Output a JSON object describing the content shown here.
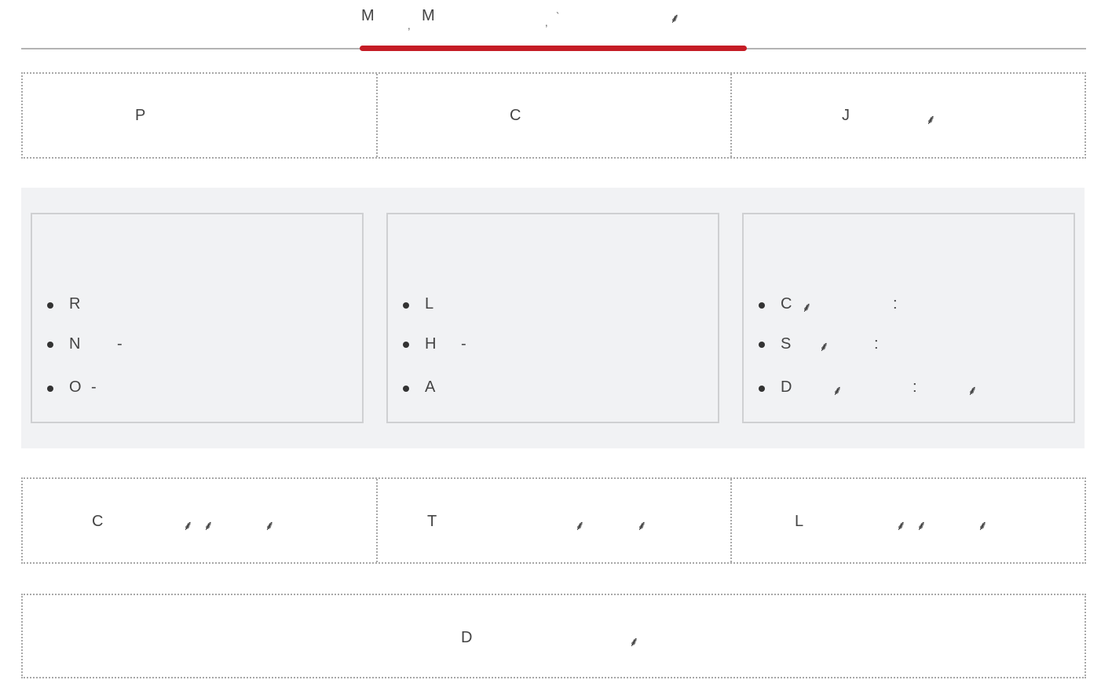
{
  "header": {
    "title_letter_1": "M",
    "title_letter_2": "M"
  },
  "top_row": {
    "cells": [
      {
        "letter": "P"
      },
      {
        "letter": "C"
      },
      {
        "letter": "J"
      }
    ]
  },
  "cards": [
    {
      "items": [
        {
          "letter": "R"
        },
        {
          "letter": "N",
          "dash": "-"
        },
        {
          "letter": "O",
          "dash": "-"
        }
      ]
    },
    {
      "items": [
        {
          "letter": "L"
        },
        {
          "letter": "H",
          "dash": "-"
        },
        {
          "letter": "A"
        }
      ]
    },
    {
      "items": [
        {
          "letter": "C",
          "colon": ":"
        },
        {
          "letter": "S",
          "colon": ":"
        },
        {
          "letter": "D",
          "colon": ":"
        }
      ]
    }
  ],
  "bottom_row": {
    "cells": [
      {
        "letter": "C"
      },
      {
        "letter": "T"
      },
      {
        "letter": "L"
      }
    ]
  },
  "footer": {
    "letter": "D"
  },
  "icons": {
    "sprig": "sprig-icon"
  },
  "colors": {
    "accent": "#c51c25",
    "panel": "#f1f2f4",
    "border": "#a8a8a8"
  }
}
